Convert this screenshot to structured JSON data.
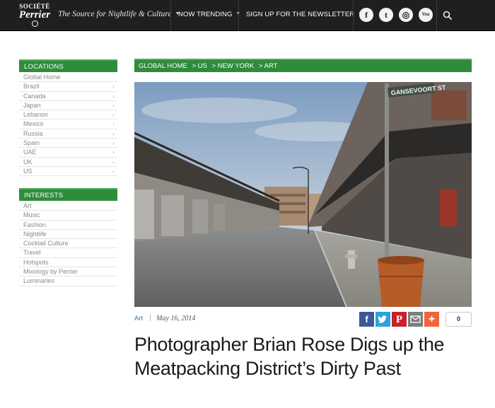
{
  "header": {
    "logo_top": "SOCIÉTÉ",
    "logo_main": "Perrier",
    "tagline": "The Source for Nightlife & Culture",
    "nav": [
      "NOW TRENDING",
      "SIGN UP FOR THE NEWSLETTER"
    ],
    "social": [
      {
        "name": "facebook",
        "glyph": "f"
      },
      {
        "name": "twitter",
        "glyph": "t"
      },
      {
        "name": "instagram",
        "glyph": "◎"
      },
      {
        "name": "youtube",
        "glyph": "You"
      }
    ]
  },
  "sidebar": {
    "locations_title": "LOCATIONS",
    "locations": [
      {
        "label": "Global Home",
        "chevron": false
      },
      {
        "label": "Brazil",
        "chevron": true
      },
      {
        "label": "Canada",
        "chevron": true
      },
      {
        "label": "Japan",
        "chevron": true
      },
      {
        "label": "Lebanon",
        "chevron": true
      },
      {
        "label": "Mexico",
        "chevron": true
      },
      {
        "label": "Russia",
        "chevron": true
      },
      {
        "label": "Spain",
        "chevron": true
      },
      {
        "label": "UAE",
        "chevron": true
      },
      {
        "label": "UK",
        "chevron": true
      },
      {
        "label": "US",
        "chevron": true
      }
    ],
    "interests_title": "INTERESTS",
    "interests": [
      "Art",
      "Music",
      "Fashion",
      "Nightlife",
      "Cocktail Culture",
      "Travel",
      "Hotspots",
      "Mixology by Perrier",
      "Luminaries"
    ]
  },
  "breadcrumb": [
    "GLOBAL HOME",
    "> US",
    "> NEW YORK",
    "> ART"
  ],
  "photo": {
    "street_sign": "GANSEVOORT ST"
  },
  "article": {
    "category": "Art",
    "date": "May 16, 2014",
    "share_count": "0",
    "title": "Photographer Brian Rose Digs up the Meatpacking District’s Dirty Past"
  },
  "colors": {
    "green": "#2f8c3c",
    "topbar": "#1f1f1f",
    "facebook": "#3b5998",
    "twitter": "#2aa3db",
    "pinterest": "#cb2027",
    "email": "#7d7d7d",
    "more": "#f0643c"
  }
}
